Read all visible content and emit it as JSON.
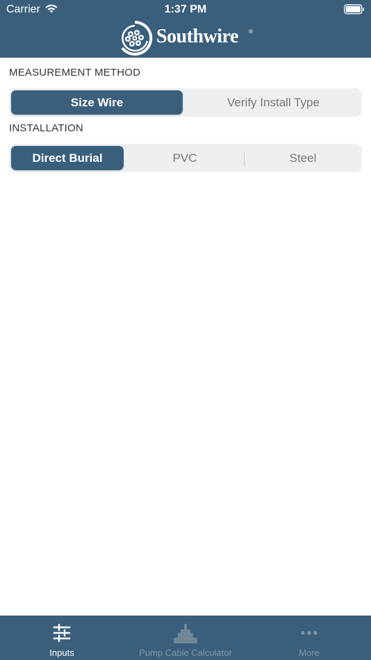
{
  "status_bar": {
    "carrier": "Carrier",
    "time": "1:37 PM"
  },
  "brand": {
    "name": "Southwire",
    "registered_mark": "®",
    "color": "#3a5f7d"
  },
  "measurement_method": {
    "label": "MEASUREMENT METHOD",
    "options": [
      "Size Wire",
      "Verify Install Type"
    ],
    "selected": "Size Wire"
  },
  "installation": {
    "label": "INSTALLATION",
    "options": [
      "Direct Burial",
      "PVC",
      "Steel"
    ],
    "selected": "Direct Burial"
  },
  "tab_bar": {
    "tabs": [
      {
        "label": "Inputs",
        "icon": "sliders-icon",
        "active": true
      },
      {
        "label": "Pump Cable Calculator",
        "icon": "pump-icon",
        "active": false
      },
      {
        "label": "More",
        "icon": "ellipsis-icon",
        "active": false
      }
    ]
  }
}
